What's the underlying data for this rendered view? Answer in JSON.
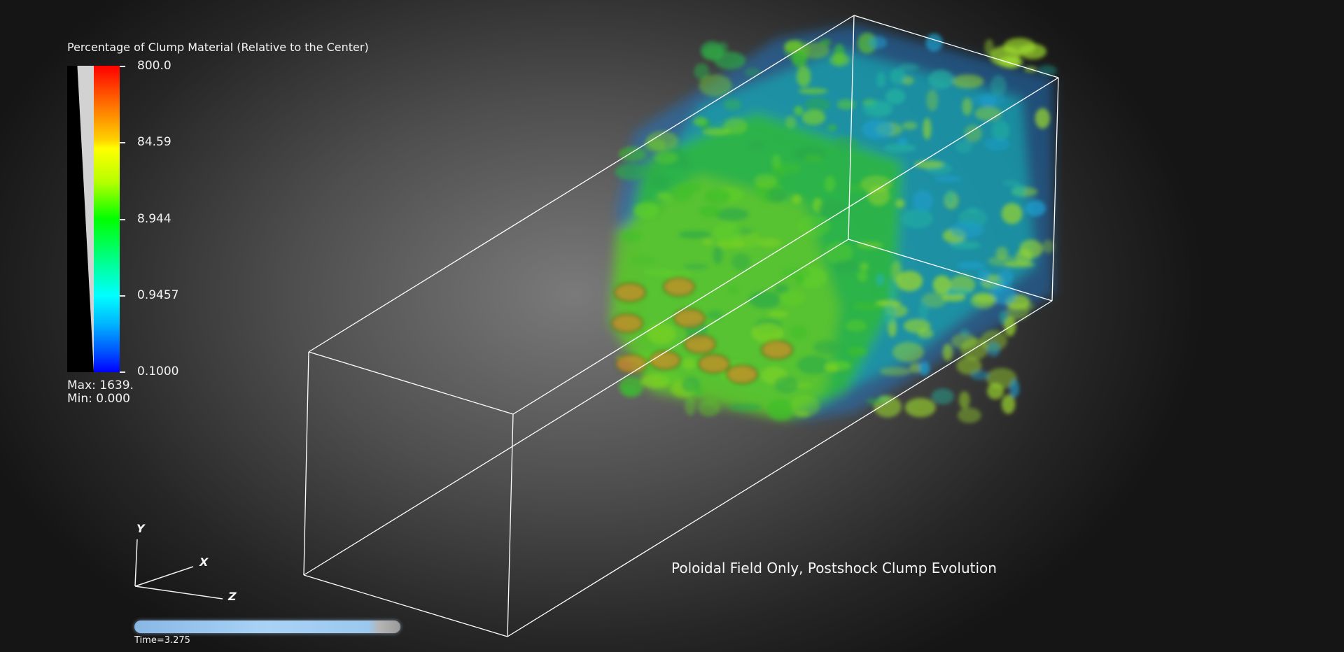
{
  "colorbar": {
    "title": "Percentage of Clump Material (Relative to the Center)",
    "ticks": [
      "800.0",
      "84.59",
      "8.944",
      "0.9457",
      "0.1000"
    ],
    "max_label": "Max:  1639.",
    "min_label": "Min:  0.000",
    "colormap": "rainbow",
    "colors": [
      "#ff0000",
      "#ffff00",
      "#00ff00",
      "#00ffff",
      "#0000ff"
    ],
    "opacity_ramp": "linear gray ramp"
  },
  "scene": {
    "caption": "Poloidal Field Only, Postshock Clump Evolution",
    "bounding_box_color": "#ffffff",
    "background": "gray radial gradient"
  },
  "axes": {
    "y": "Y",
    "x": "X",
    "z": "Z"
  },
  "time": {
    "label": "Time=3.275",
    "progress": 0.9
  }
}
